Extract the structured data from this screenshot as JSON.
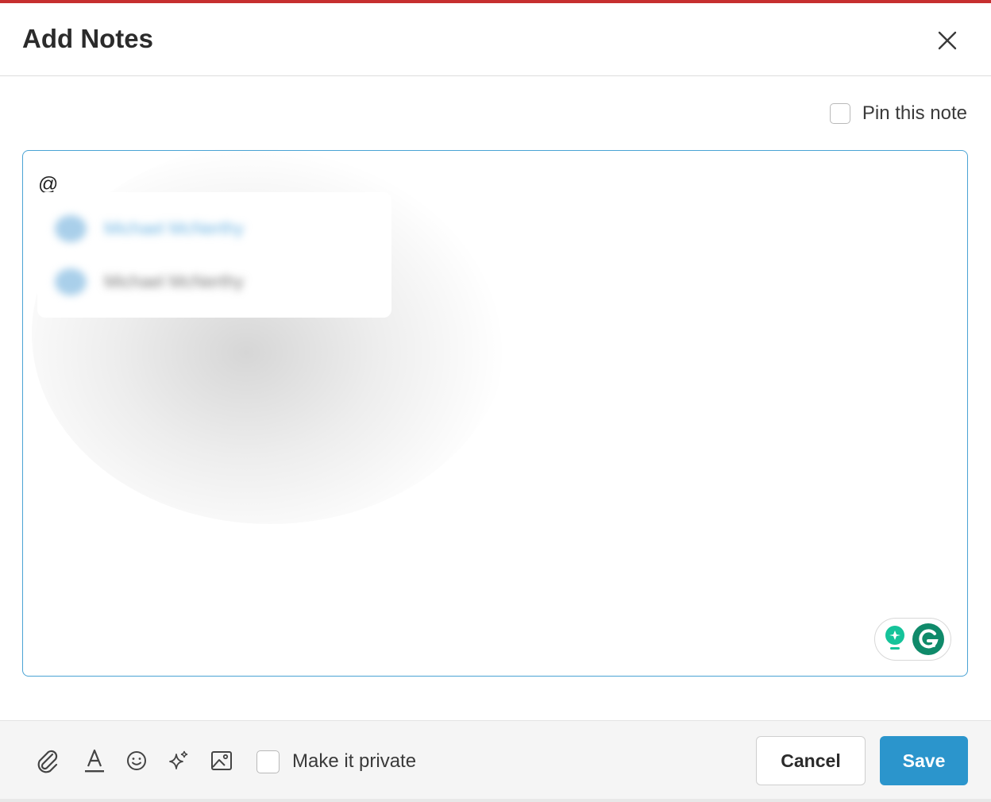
{
  "dialog": {
    "title": "Add Notes",
    "close_icon": "close-icon"
  },
  "pin": {
    "label": "Pin this note",
    "checked": false
  },
  "editor": {
    "text": "@"
  },
  "mention_popup": {
    "items": [
      {
        "name": "Michael McNerthy",
        "highlighted": true
      },
      {
        "name": "Michael McNerthy",
        "highlighted": false
      }
    ]
  },
  "toolbar": {
    "icons": [
      "paperclip-icon",
      "text-format-icon",
      "emoji-icon",
      "sparkle-icon",
      "image-icon"
    ],
    "private_label": "Make it private",
    "private_checked": false
  },
  "actions": {
    "cancel_label": "Cancel",
    "save_label": "Save"
  },
  "colors": {
    "top_accent": "#c62f2f",
    "editor_border": "#4aa3d4",
    "save_button": "#2b95cc",
    "grammarly_green": "#15c39a"
  }
}
